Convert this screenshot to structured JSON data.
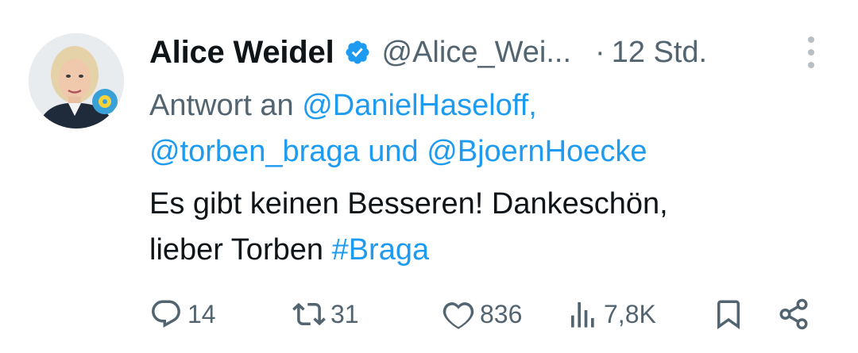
{
  "tweet": {
    "author_name": "Alice Weidel",
    "handle": "@Alice_Wei...",
    "separator": "·",
    "time": "12 Std.",
    "reply_prefix": "Antwort an",
    "reply_mention_1": "@DanielHaseloff,",
    "reply_mention_2": "@torben_braga",
    "reply_and": "und",
    "reply_mention_3": "@BjoernHoecke",
    "text_line_1": "Es gibt keinen Besseren! Dankeschön,",
    "text_line_2_plain": "lieber Torben",
    "hashtag": "#Braga"
  },
  "actions": {
    "replies": "14",
    "reposts": "31",
    "likes": "836",
    "views": "7,8K"
  },
  "icons": {
    "verified": "verified-badge-icon",
    "more": "more-vertical-icon",
    "reply": "reply-icon",
    "repost": "repost-icon",
    "like": "heart-icon",
    "views": "views-chart-icon",
    "bookmark": "bookmark-icon",
    "share": "share-icon"
  },
  "colors": {
    "accent": "#1d9bf0",
    "text": "#0f1419",
    "secondary": "#536471"
  }
}
